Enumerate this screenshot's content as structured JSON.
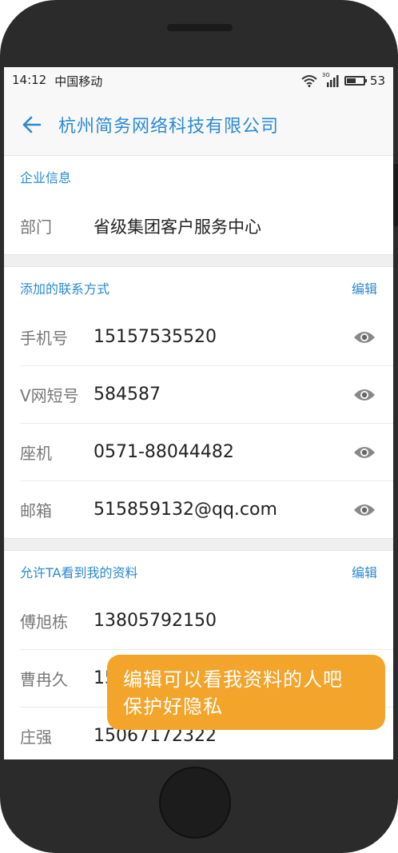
{
  "status_bar": {
    "time": "14:12",
    "carrier": "中国移动",
    "network": "3G",
    "battery": "53",
    "battery_level": 0.53
  },
  "header": {
    "title": "杭州简务网络科技有限公司"
  },
  "company_section": {
    "title": "企业信息",
    "rows": [
      {
        "label": "部门",
        "value": "省级集团客户服务中心"
      }
    ]
  },
  "contact_section": {
    "title": "添加的联系方式",
    "edit_label": "编辑",
    "rows": [
      {
        "label": "手机号",
        "value": "15157535520"
      },
      {
        "label": "V网短号",
        "value": "584587"
      },
      {
        "label": "座机",
        "value": "0571-88044482"
      },
      {
        "label": "邮箱",
        "value": "515859132@qq.com"
      }
    ]
  },
  "allowed_section": {
    "title": "允许TA看到我的资料",
    "edit_label": "编辑",
    "rows": [
      {
        "label": "傅旭栋",
        "value": "13805792150"
      },
      {
        "label": "曹冉久",
        "value": "15"
      },
      {
        "label": "庄强",
        "value": "15067172322"
      }
    ]
  },
  "tooltip": {
    "line1": "编辑可以看我资料的人吧",
    "line2": "保护好隐私"
  },
  "icons": {
    "back": "back-arrow-icon",
    "eye": "eye-icon",
    "wifi": "wifi-icon",
    "signal": "signal-icon",
    "battery": "battery-icon"
  },
  "colors": {
    "accent": "#2a8ad4",
    "tooltip": "#f3a42a",
    "phone_body": "#2b2b2b"
  }
}
